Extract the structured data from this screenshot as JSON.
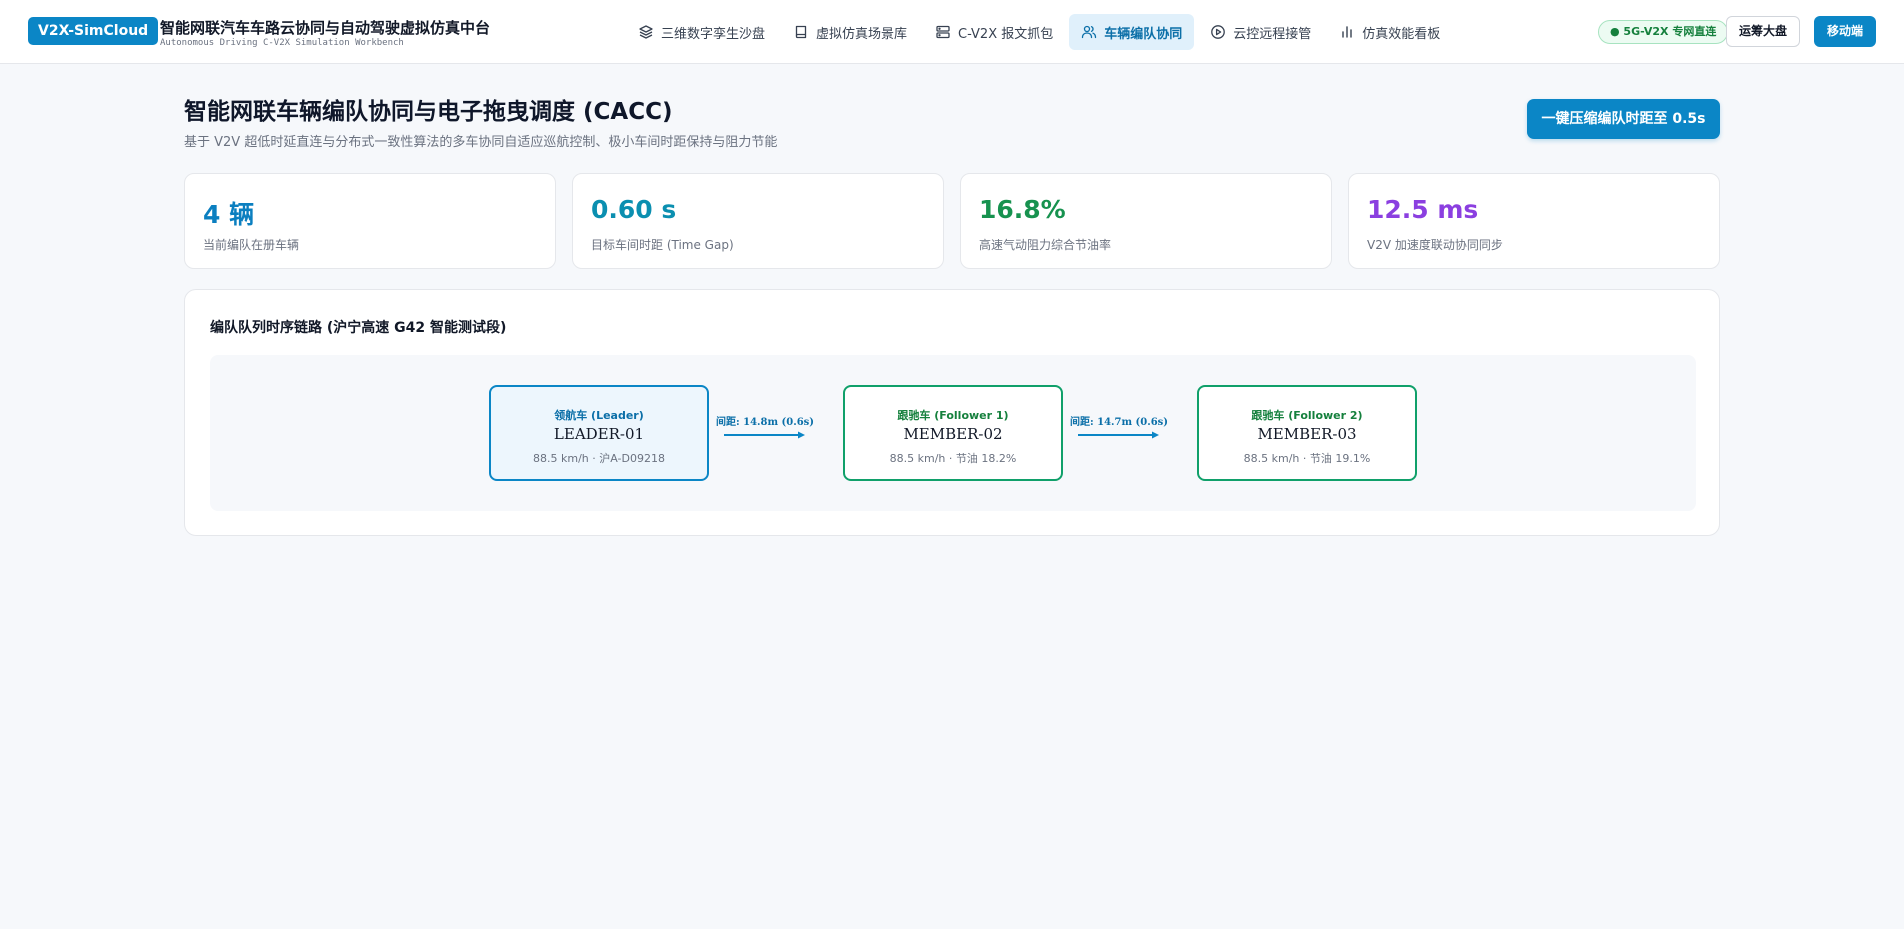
{
  "app": {
    "logo": "V2X-SimCloud",
    "title": "智能网联汽车车路云协同与自动驾驶虚拟仿真中台",
    "subtitle": "Autonomous Driving C-V2X Simulation Workbench"
  },
  "nav": {
    "items": [
      {
        "label": "三维数字孪生沙盘",
        "icon": "layers-icon",
        "active": false
      },
      {
        "label": "虚拟仿真场景库",
        "icon": "book-icon",
        "active": false
      },
      {
        "label": "C-V2X 报文抓包",
        "icon": "server-icon",
        "active": false
      },
      {
        "label": "车辆编队协同",
        "icon": "users-icon",
        "active": true
      },
      {
        "label": "云控远程接管",
        "icon": "play-circle-icon",
        "active": false
      },
      {
        "label": "仿真效能看板",
        "icon": "bar-chart-icon",
        "active": false
      }
    ]
  },
  "header_right": {
    "status": "● 5G-V2X 专网直连",
    "ops_button": "运筹大盘",
    "mobile_button": "移动端"
  },
  "page": {
    "title": "智能网联车辆编队协同与电子拖曳调度 (CACC)",
    "subtitle": "基于 V2V 超低时延直连与分布式一致性算法的多车协同自适应巡航控制、极小车间时距保持与阻力节能",
    "action_button": "一键压缩编队时距至 0.5s"
  },
  "metrics": [
    {
      "value": "4 辆",
      "label": "当前编队在册车辆",
      "color": "#0b7fc0"
    },
    {
      "value": "0.60 s",
      "label": "目标车间时距 (Time Gap)",
      "color": "#0b8fb0"
    },
    {
      "value": "16.8%",
      "label": "高速气动阻力综合节油率",
      "color": "#17924f"
    },
    {
      "value": "12.5 ms",
      "label": "V2V 加速度联动协同同步",
      "color": "#8b3fe0"
    }
  ],
  "platoon": {
    "title": "编队队列时序链路 (沪宁高速 G42 智能测试段)",
    "vehicles": [
      {
        "role": "领航车 (Leader)",
        "id": "LEADER-01",
        "meta": "88.5 km/h · 沪A-D09218"
      },
      {
        "role": "跟驰车 (Follower 1)",
        "id": "MEMBER-02",
        "meta": "88.5 km/h · 节油 18.2%"
      },
      {
        "role": "跟驰车 (Follower 2)",
        "id": "MEMBER-03",
        "meta": "88.5 km/h · 节油 19.1%"
      }
    ],
    "gaps": [
      {
        "label": "间距: 14.8m (0.6s)"
      },
      {
        "label": "间距: 14.7m (0.6s)"
      }
    ]
  }
}
